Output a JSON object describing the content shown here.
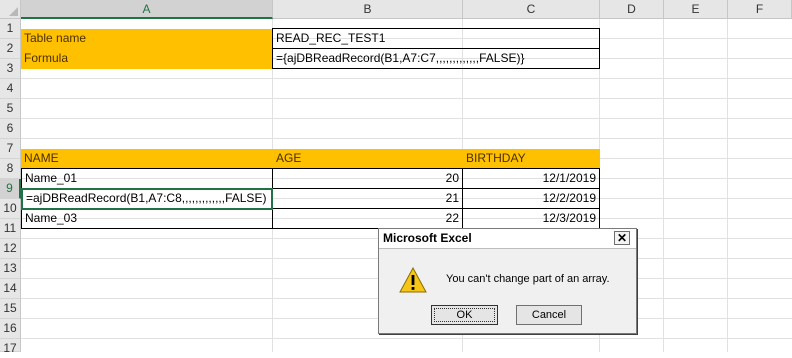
{
  "columns": [
    "A",
    "B",
    "C",
    "D",
    "E",
    "F"
  ],
  "rows": [
    "1",
    "2",
    "3",
    "4",
    "5",
    "6",
    "7",
    "8",
    "9",
    "10",
    "11",
    "12",
    "13",
    "14",
    "15",
    "16",
    "17"
  ],
  "cells": {
    "a1": "Table name",
    "b1": "READ_REC_TEST1",
    "a2": "Formula",
    "b2": "={ajDBReadRecord(B1,A7:C7,,,,,,,,,,,,,FALSE)}",
    "a7": "NAME",
    "b7": "AGE",
    "c7": "BIRTHDAY",
    "a8": "Name_01",
    "b8": "20",
    "c8": "12/1/2019",
    "a9": "=ajDBReadRecord(B1,A7:C8,,,,,,,,,,,,,FALSE)",
    "b9": "21",
    "c9": "12/2/2019",
    "a10": "Name_03",
    "b10": "22",
    "c10": "12/3/2019"
  },
  "dialog": {
    "title": "Microsoft Excel",
    "close": "✕",
    "message": "You can't change part of an array.",
    "ok": "OK",
    "cancel": "Cancel"
  },
  "colors": {
    "header_fill": "#ffc000",
    "selection": "#217346"
  }
}
